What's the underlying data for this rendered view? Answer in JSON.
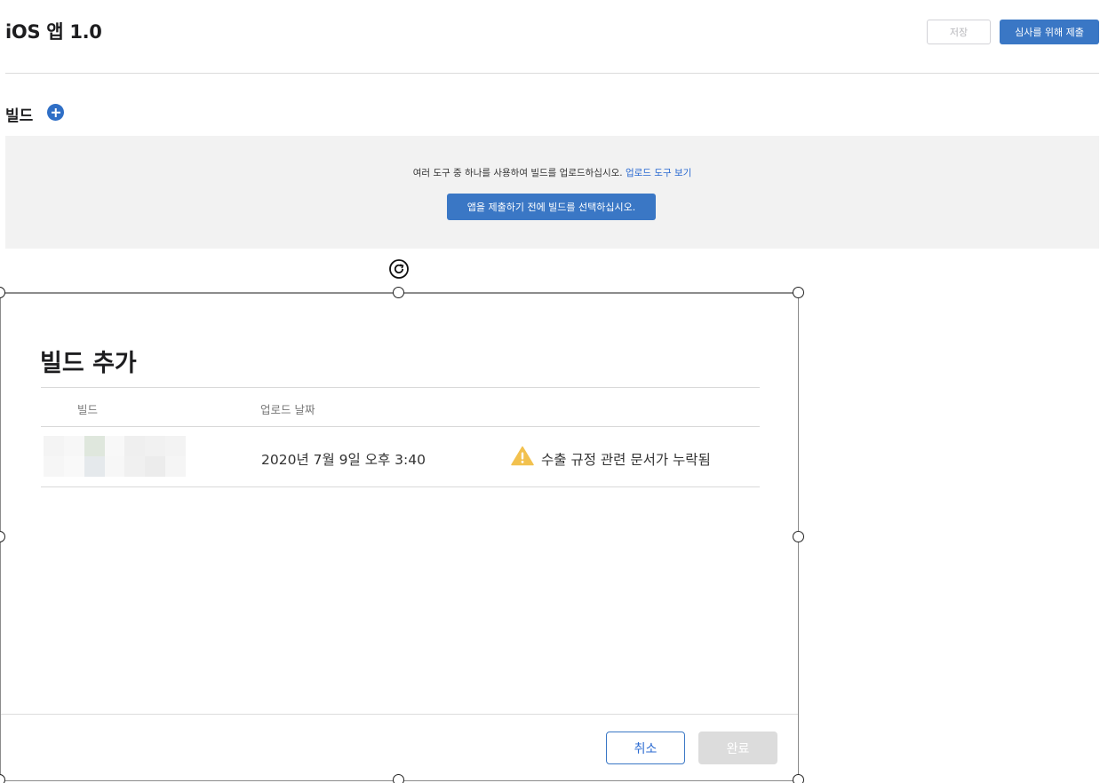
{
  "header": {
    "title": "iOS 앱 1.0",
    "save_label": "저장",
    "submit_label": "심사를 위해 제출"
  },
  "builds": {
    "section_title": "빌드",
    "panel_message": "여러 도구 중 하나를 사용하여 빌드를 업로드하십시오.",
    "panel_link": "업로드 도구 보기",
    "select_button": "앱을 제출하기 전에 빌드를 선택하십시오."
  },
  "dialog": {
    "title": "빌드 추가",
    "columns": [
      "빌드",
      "업로드 날짜"
    ],
    "rows": [
      {
        "upload_date": "2020년 7월 9일 오후 3:40",
        "warning": "수출 규정 관련 문서가 누락됨"
      }
    ],
    "cancel_label": "취소",
    "done_label": "완료"
  },
  "colors": {
    "accent": "#3a77c5",
    "link": "#2a6ad1",
    "warning": "#f2c14e",
    "panel_bg": "#f2f2f2",
    "disabled": "#dcdcdc"
  },
  "icons": [
    "add-circle-icon",
    "rotate-icon",
    "warning-icon"
  ]
}
